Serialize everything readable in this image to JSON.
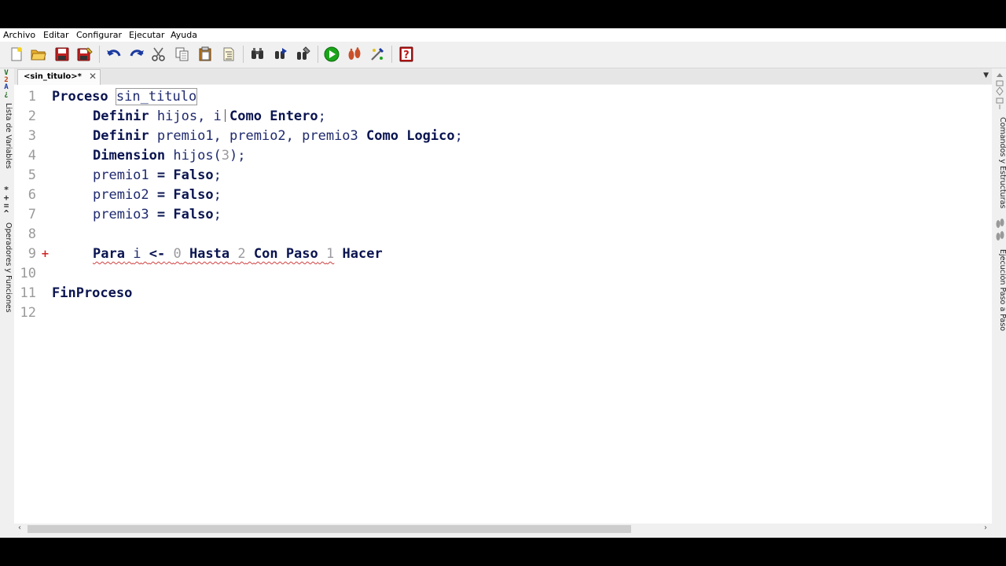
{
  "menu": [
    "Archivo",
    "Editar",
    "Configurar",
    "Ejecutar",
    "Ayuda"
  ],
  "toolbar": {
    "icons": [
      "new-file-icon",
      "open-folder-icon",
      "save-icon",
      "save-as-icon",
      "undo-icon",
      "redo-icon",
      "cut-icon",
      "copy-icon",
      "paste-icon",
      "correct-indentation-icon",
      "find-icon",
      "find-next-icon",
      "replace-icon",
      "run-icon",
      "step-by-step-icon",
      "debug-icon",
      "help-icon"
    ],
    "colors": {
      "run": "#1aa51a",
      "help": "#c01818"
    }
  },
  "tab": {
    "label": "<sin_titulo>*",
    "close": "✕"
  },
  "left_panel": {
    "variables_label": "Lista de Variables",
    "variables_icon_text": [
      "V",
      "2",
      "A",
      "¿"
    ],
    "operators_label": "Operadores y Funciones",
    "operators_icon_text": [
      "*",
      "+",
      "=",
      "^"
    ]
  },
  "right_panel": {
    "commands_label": "Comandos y Estructuras",
    "step_label": "Ejecución Paso a Paso"
  },
  "editor": {
    "line_numbers": [
      "1",
      "2",
      "3",
      "4",
      "5",
      "6",
      "7",
      "8",
      "9",
      "10",
      "11",
      "12"
    ],
    "marker_line9": "+",
    "l1": {
      "kw": "Proceso",
      "name": "sin_titulo"
    },
    "l2": {
      "kw": "Definir",
      "ids": "hijos, i",
      "kw2": "Como Entero",
      "end": ";"
    },
    "l3": {
      "kw": "Definir",
      "ids": "premio1, premio2, premio3",
      "kw2": "Como Logico",
      "end": ";"
    },
    "l4": {
      "kw": "Dimension",
      "id": "hijos(",
      "num": "3",
      "end": ");"
    },
    "l5": {
      "id": "premio1",
      "op": "=",
      "val": "Falso",
      "end": ";"
    },
    "l6": {
      "id": "premio2",
      "op": "=",
      "val": "Falso",
      "end": ";"
    },
    "l7": {
      "id": "premio3",
      "op": "=",
      "val": "Falso",
      "end": ";"
    },
    "l9": {
      "kw1": "Para",
      "var": "i",
      "op": "<-",
      "n1": "0",
      "kw2": "Hasta",
      "n2": "2",
      "kw3": "Con Paso",
      "n3": "1",
      "kw4": "Hacer"
    },
    "l11": {
      "kw": "FinProceso"
    }
  },
  "scroll": {
    "left": "‹",
    "right": "›",
    "dropdown": "▼"
  }
}
